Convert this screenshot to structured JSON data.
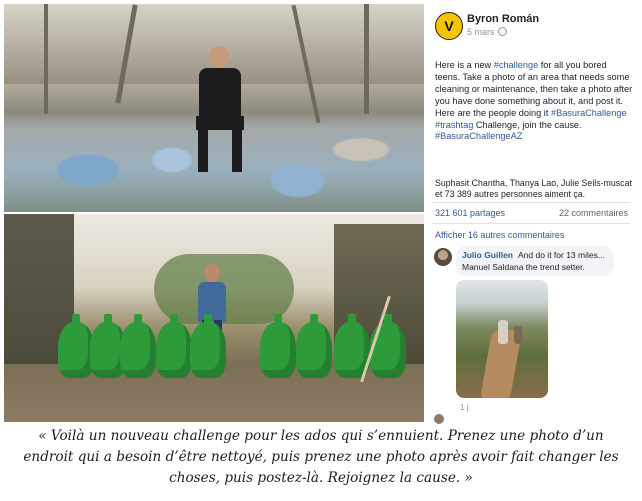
{
  "post": {
    "author": "Byron Román",
    "date": "5 mars",
    "logo_letter": "V",
    "text_parts": {
      "p1": "Here is a new ",
      "tag1": "#challenge",
      "p2": " for all you bored teens. Take a photo of an area that needs some cleaning or maintenance, then take a photo after you have done something about it, and post it. Here are the people doing it ",
      "tag2": "#BasuraChallenge",
      "p3": " ",
      "tag3": "#trashtag",
      "p4": " Challenge, join the cause. ",
      "tag4": "#BasuraChallengeAZ"
    },
    "likes": "Suphasit Chantha, Thanya Lao, Julie Seils-muscat et 73 389 autres personnes aiment ça.",
    "shares": "321 601 partages",
    "comments_count": "22 commentaires",
    "more_comments": "Afficher 16 autres commentaires",
    "comment": {
      "name": "Julio Guillen",
      "text": "And do it for 13 miles...",
      "line2": "Manuel Saldana the trend setter.",
      "footer": "1 j"
    }
  },
  "caption": "« Voilà un nouveau challenge pour les ados qui s’ennuient. Prenez une photo d’un endroit qui a besoin d’être nettoyé, puis prenez une photo après avoir fait changer les choses, puis postez-là. Rejoignez la cause. »",
  "colors": {
    "link": "#365899",
    "bag": "#2e9b3b",
    "logo": "#f5c400"
  }
}
